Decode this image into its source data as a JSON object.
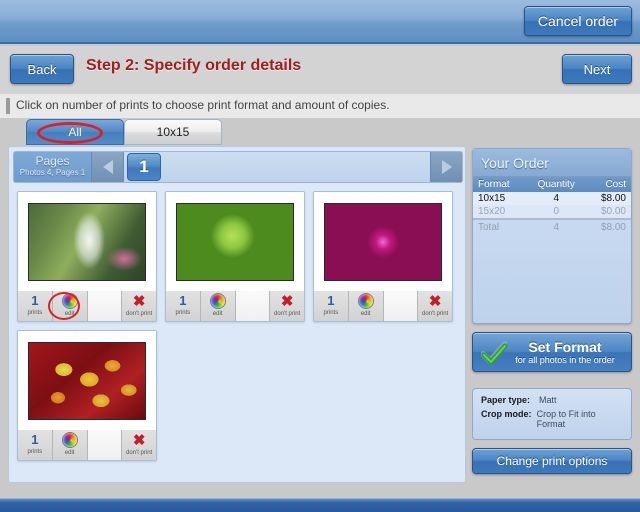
{
  "topbar": {
    "cancel_label": "Cancel order"
  },
  "stepbar": {
    "back_label": "Back",
    "next_label": "Next",
    "title": "Step 2: Specify order details"
  },
  "hint": {
    "text": "Click on number of prints to choose print format and amount of copies."
  },
  "tabs": [
    {
      "label": "All",
      "active": true,
      "annotated": true
    },
    {
      "label": "10x15",
      "active": false,
      "annotated": false
    }
  ],
  "pages_nav": {
    "label": "Pages",
    "sublabel": "Photos 4, Pages 1",
    "prev_icon": "triangle-left-icon",
    "next_icon": "triangle-right-icon",
    "current_page": "1"
  },
  "photos": [
    {
      "name": "waterfall",
      "art_class": "img-waterfall",
      "prints": "1",
      "prints_caption": "prints",
      "edit_caption": "edit",
      "dont_print_caption": "don't print",
      "edit_annotated": true
    },
    {
      "name": "green-succulent",
      "art_class": "img-green",
      "prints": "1",
      "prints_caption": "prints",
      "edit_caption": "edit",
      "dont_print_caption": "don't print",
      "edit_annotated": false
    },
    {
      "name": "magenta-dahlia",
      "art_class": "img-dahlia",
      "prints": "1",
      "prints_caption": "prints",
      "edit_caption": "edit",
      "dont_print_caption": "don't print",
      "edit_annotated": false
    },
    {
      "name": "autumn-leaves",
      "art_class": "img-leaves",
      "prints": "1",
      "prints_caption": "prints",
      "edit_caption": "edit",
      "dont_print_caption": "don't print",
      "edit_annotated": false
    }
  ],
  "order": {
    "title": "Your Order",
    "columns": [
      "Format",
      "Quantity",
      "Cost"
    ],
    "rows": [
      {
        "format": "10x15",
        "quantity": "4",
        "cost": "$8.00",
        "state": "active"
      },
      {
        "format": "15x20",
        "quantity": "0",
        "cost": "$0.00",
        "state": "inactive"
      }
    ],
    "total": {
      "format": "Total",
      "quantity": "4",
      "cost": "$8.00"
    }
  },
  "set_format": {
    "title": "Set Format",
    "subtitle": "for all photos in the order",
    "icon": "green-check-icon"
  },
  "print_options": {
    "paper_type_key": "Paper type:",
    "paper_type_value": "Matt",
    "crop_mode_key": "Crop mode:",
    "crop_mode_value": "Crop to Fit into Format",
    "change_label": "Change print options"
  },
  "colors": {
    "accent_blue": "#3f79bd",
    "title_red": "#9e2020",
    "annotation_red": "#d8222a",
    "panel_blue": "#dce8f7"
  }
}
